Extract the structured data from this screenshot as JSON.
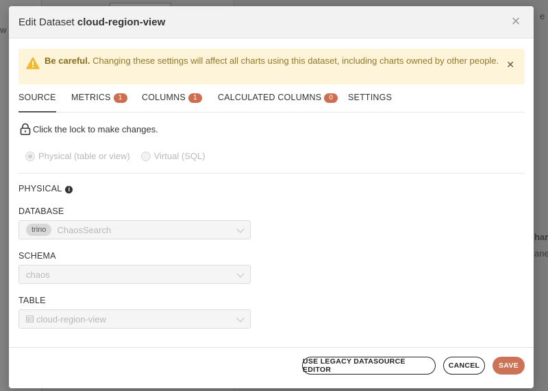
{
  "modal": {
    "title_prefix": "Edit Dataset",
    "title_name": "cloud-region-view",
    "close_icon": "close-icon"
  },
  "alert": {
    "strong": "Be careful.",
    "text": "Changing these settings will affect all charts using this dataset, including charts owned by other people.",
    "icon": "warning-icon",
    "color_bg": "#fdf4da",
    "color_text": "#94792a"
  },
  "tabs": [
    {
      "label": "SOURCE",
      "badge": null
    },
    {
      "label": "METRICS",
      "badge": "1"
    },
    {
      "label": "COLUMNS",
      "badge": "1"
    },
    {
      "label": "CALCULATED COLUMNS",
      "badge": "0"
    },
    {
      "label": "SETTINGS",
      "badge": null
    }
  ],
  "lock_text": "Click the lock to make changes.",
  "source_type": {
    "options": [
      "Physical (table or view)",
      "Virtual (SQL)"
    ],
    "selected": "Physical (table or view)"
  },
  "physical": {
    "heading": "PHYSICAL",
    "database": {
      "label": "DATABASE",
      "backend": "trino",
      "value": "ChaosSearch"
    },
    "schema": {
      "label": "SCHEMA",
      "value": "chaos"
    },
    "table": {
      "label": "TABLE",
      "value": "cloud-region-view"
    }
  },
  "footer": {
    "legacy_label": "USE LEGACY DATASOURCE EDITOR",
    "cancel_label": "CANCEL",
    "save_label": "SAVE"
  },
  "colors": {
    "accent": "#cc7256",
    "badge": "#cd6e51"
  },
  "background": {
    "partial_texts": [
      "w",
      "e",
      "har",
      "ane"
    ]
  }
}
